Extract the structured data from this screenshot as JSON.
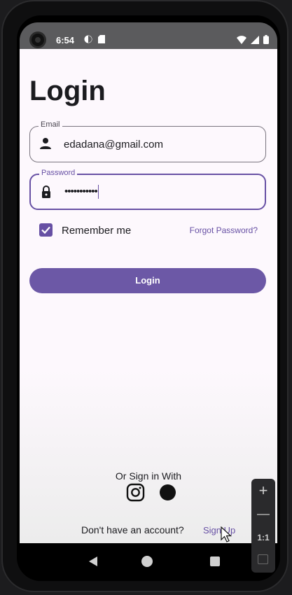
{
  "status_bar": {
    "time": "6:54",
    "icons": [
      "data-saver-icon",
      "sim-card-icon",
      "wifi-icon",
      "signal-icon",
      "battery-icon"
    ]
  },
  "screen": {
    "title": "Login",
    "email": {
      "label": "Email",
      "value": "edadana@gmail.com",
      "icon": "person-icon"
    },
    "password": {
      "label": "Password",
      "value": "•••••••••••",
      "icon": "lock-icon"
    },
    "remember_me": {
      "label": "Remember me",
      "checked": true
    },
    "forgot_password": "Forgot Password?",
    "login_button": "Login",
    "or_sign_in": "Or Sign in With",
    "social_icons": [
      "instagram-icon",
      "circle-icon"
    ],
    "no_account": "Don't have an account?",
    "sign_up": "Sign Up"
  },
  "emulator_controls": {
    "zoom_in": "+",
    "zoom_ratio": "1:1"
  },
  "colors": {
    "primary": "#6750a4",
    "button": "#6c58a6",
    "background": "#fdf8fd"
  }
}
